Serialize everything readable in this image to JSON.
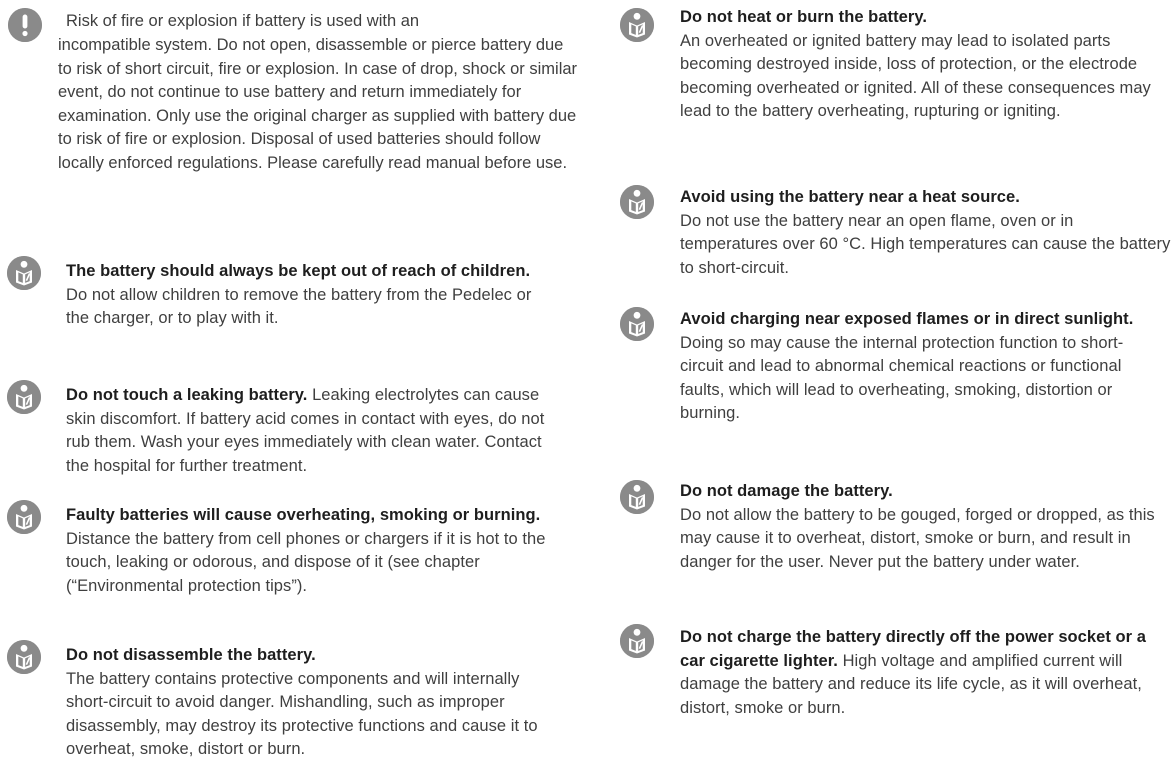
{
  "left": {
    "warning": {
      "icon": "exclamation-warning-icon",
      "line1": "Risk of fire or explosion if battery is used with an",
      "rest": "incompatible system. Do not open, disassemble or pierce battery due to risk of short circuit, fire or explosion. In case of drop, shock or similar event, do not continue to use battery and return immediately for examination. Only use the original charger as supplied with battery due to risk of fire or explosion. Disposal of used batteries should follow locally enforced regulations. Please carefully read manual before use."
    },
    "items": [
      {
        "icon": "read-manual-icon",
        "title": "The battery should always be kept out of reach of children.",
        "body": "Do not allow children to remove the battery from the Pedelec or the charger, or to play with it.",
        "inline": false
      },
      {
        "icon": "read-manual-icon",
        "title": "Do not touch a leaking battery.",
        "body": "Leaking electrolytes can cause skin discomfort. If battery acid comes in contact with eyes, do not rub them. Wash your eyes immediately with clean water. Contact the hospital for further treatment.",
        "inline": true
      },
      {
        "icon": "read-manual-icon",
        "title": "Faulty batteries will cause overheating, smoking or burning.",
        "body": "Distance the battery from cell phones or chargers if it is hot to the touch, leaking or odorous, and dispose of it (see chapter (“Environmental protection tips”).",
        "inline": false
      },
      {
        "icon": "read-manual-icon",
        "title": "Do not disassemble the battery.",
        "body": "The battery contains protective components and will internally short-circuit to avoid danger. Mishandling, such as improper disassembly, may destroy its protective functions and cause it to overheat, smoke, distort or burn.",
        "inline": false
      }
    ]
  },
  "right": {
    "items": [
      {
        "icon": "read-manual-icon",
        "title": "Do not heat or burn the battery.",
        "body": "An overheated or ignited battery may lead to isolated parts becoming destroyed inside, loss of protection, or the electrode becoming overheated or ignited. All of these consequences may lead to the battery overheating, rupturing or igniting.",
        "inline": false
      },
      {
        "icon": "read-manual-icon",
        "title": "Avoid using the battery near a heat source.",
        "body": "Do not use the battery near an open flame, oven or in temperatures over 60 °C. High temperatures can cause the battery to short-circuit.",
        "inline": false
      },
      {
        "icon": "read-manual-icon",
        "title": "Avoid charging near exposed flames or in direct sunlight.",
        "body": "Doing so may cause the internal protection function to short-circuit and lead to abnormal chemical reactions or functional faults, which will lead to overheating, smoking, distortion or burning.",
        "inline": false
      },
      {
        "icon": "read-manual-icon",
        "title": "Do not damage the battery.",
        "body": "Do not allow the battery to be gouged, forged or dropped, as this may cause it to overheat, distort, smoke or burn, and result in danger for the user. Never put the battery under water.",
        "inline": false
      },
      {
        "icon": "read-manual-icon",
        "title": "Do not charge the battery directly off the power socket or a car cigarette lighter.",
        "body": "High voltage and amplified current will damage the battery and reduce its life cycle, as it will overheat, distort, smoke or burn.",
        "inline": true
      }
    ]
  }
}
